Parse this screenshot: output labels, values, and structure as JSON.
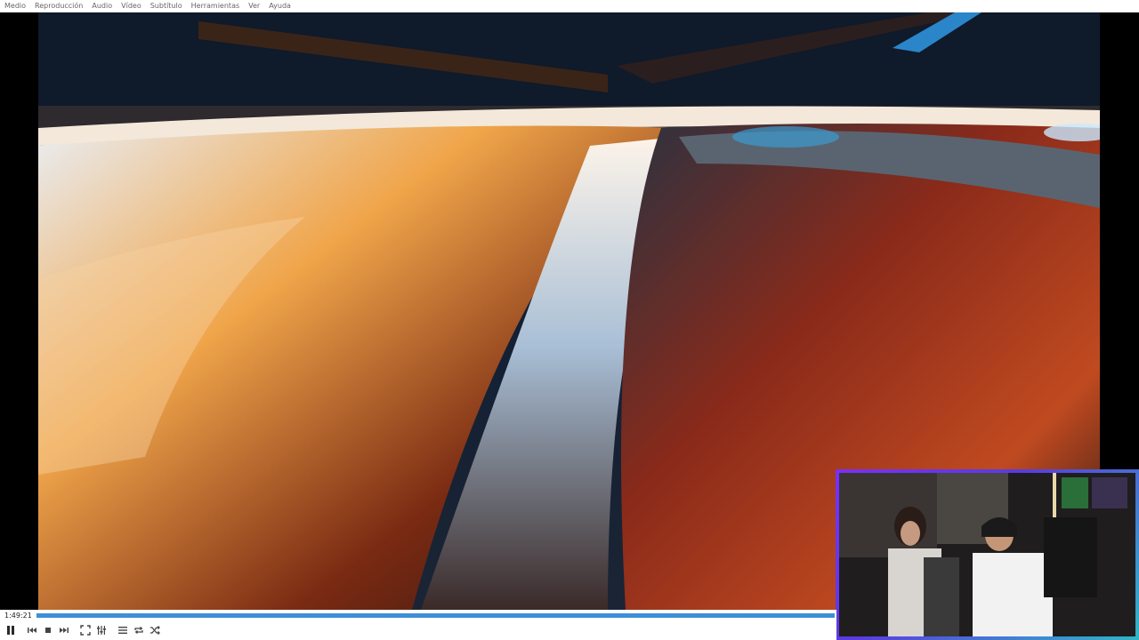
{
  "menu": {
    "items": [
      {
        "label": "Medio"
      },
      {
        "label": "Reproducción"
      },
      {
        "label": "Audio"
      },
      {
        "label": "Vídeo"
      },
      {
        "label": "Subtítulo"
      },
      {
        "label": "Herramientas"
      },
      {
        "label": "Ver"
      },
      {
        "label": "Ayuda"
      }
    ]
  },
  "player": {
    "elapsed_time": "1:49:21",
    "progress": 1.0
  },
  "controls": {
    "icons": [
      "pause-icon",
      "previous-icon",
      "stop-icon",
      "next-icon",
      "fullscreen-icon",
      "extended-settings-icon",
      "playlist-icon",
      "loop-icon",
      "shuffle-icon"
    ]
  },
  "colors": {
    "progress_fill": "#3d8fd8",
    "webcam_border_start": "#7b2ff7",
    "webcam_border_end": "#2fb7c7"
  }
}
